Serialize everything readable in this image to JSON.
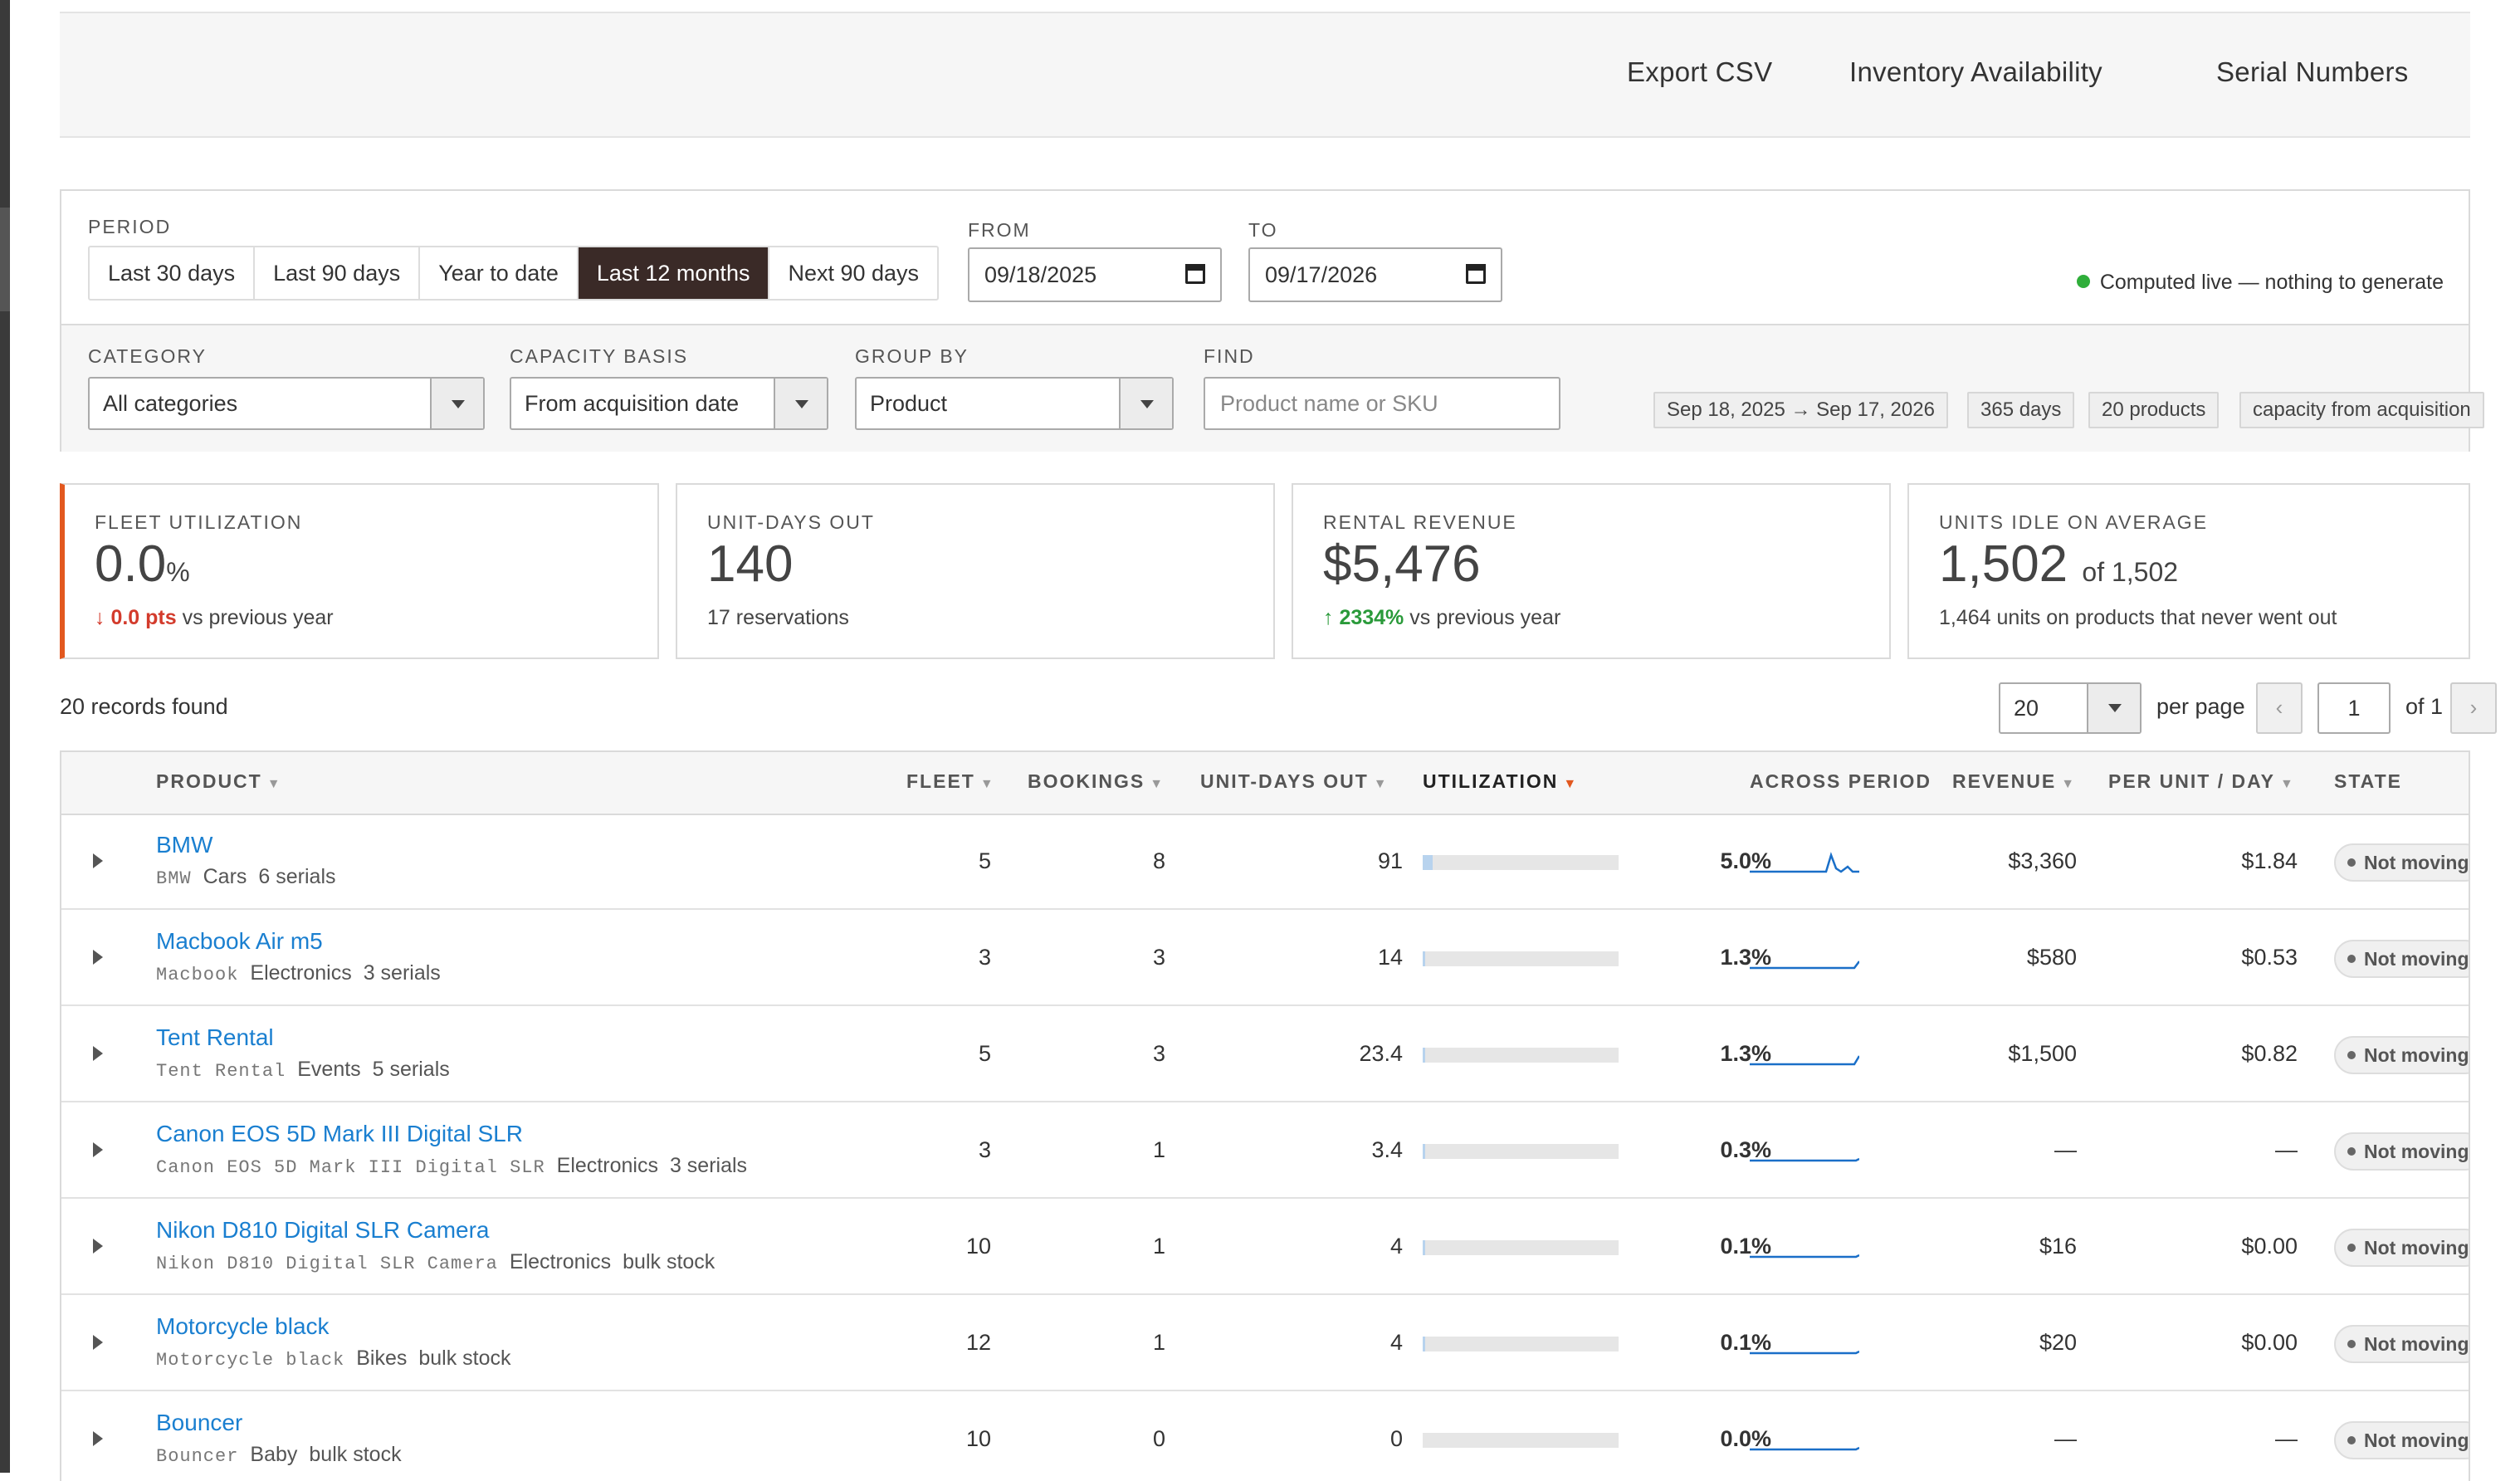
{
  "toolbar": {
    "export_csv": "Export CSV",
    "inventory_availability": "Inventory Availability",
    "serial_numbers": "Serial Numbers"
  },
  "filters": {
    "period_label": "PERIOD",
    "periods": [
      "Last 30 days",
      "Last 90 days",
      "Year to date",
      "Last 12 months",
      "Next 90 days"
    ],
    "active_period": "Last 12 months",
    "from_label": "FROM",
    "from_value": "09/18/2025",
    "to_label": "TO",
    "to_value": "09/17/2026",
    "live_status": "Computed live — nothing to generate",
    "category_label": "CATEGORY",
    "category_value": "All categories",
    "capacity_label": "CAPACITY BASIS",
    "capacity_value": "From acquisition date",
    "group_label": "GROUP BY",
    "group_value": "Product",
    "find_label": "FIND",
    "find_placeholder": "Product name or SKU",
    "chips": [
      "Sep 18, 2025 → Sep 17, 2026",
      "365 days",
      "20 products",
      "capacity from acquisition"
    ]
  },
  "kpis": {
    "fleet_utilization": {
      "label": "FLEET UTILIZATION",
      "value": "0.0",
      "unit": "%",
      "delta": "↓ 0.0 pts",
      "delta_suffix": "vs previous year"
    },
    "unit_days_out": {
      "label": "UNIT-DAYS OUT",
      "value": "140",
      "sub": "17 reservations"
    },
    "rental_revenue": {
      "label": "RENTAL REVENUE",
      "value": "$5,476",
      "delta": "↑ 2334%",
      "delta_suffix": "vs previous year"
    },
    "units_idle": {
      "label": "UNITS IDLE ON AVERAGE",
      "value": "1,502",
      "of": "of 1,502",
      "sub": "1,464 units on products that never went out"
    }
  },
  "pagination": {
    "records_found": "20 records found",
    "per_page_value": "20",
    "per_page_label": "per page",
    "prev": "‹",
    "page": "1",
    "of_label": "of  1",
    "next": "›"
  },
  "table": {
    "headers": {
      "product": "PRODUCT",
      "fleet": "FLEET",
      "bookings": "BOOKINGS",
      "unit_days_out": "UNIT-DAYS OUT",
      "utilization": "UTILIZATION",
      "across_period": "ACROSS PERIOD",
      "revenue": "REVENUE",
      "per_unit_day": "PER UNIT / DAY",
      "state": "STATE"
    },
    "rows": [
      {
        "name": "BMW",
        "sku": "BMW",
        "category": "Cars",
        "stock": "6 serials",
        "fleet": "5",
        "bookings": "8",
        "unit_days": "91",
        "utilization": "5.0%",
        "util_fraction": 0.05,
        "revenue": "$3,360",
        "per_unit_day": "$1.84",
        "state": "Not moving"
      },
      {
        "name": "Macbook Air m5",
        "sku": "Macbook",
        "category": "Electronics",
        "stock": "3 serials",
        "fleet": "3",
        "bookings": "3",
        "unit_days": "14",
        "utilization": "1.3%",
        "util_fraction": 0.013,
        "revenue": "$580",
        "per_unit_day": "$0.53",
        "state": "Not moving"
      },
      {
        "name": "Tent Rental",
        "sku": "Tent Rental",
        "category": "Events",
        "stock": "5 serials",
        "fleet": "5",
        "bookings": "3",
        "unit_days": "23.4",
        "utilization": "1.3%",
        "util_fraction": 0.013,
        "revenue": "$1,500",
        "per_unit_day": "$0.82",
        "state": "Not moving"
      },
      {
        "name": "Canon EOS 5D Mark III Digital SLR",
        "sku": "Canon EOS 5D Mark III Digital SLR",
        "category": "Electronics",
        "stock": "3 serials",
        "fleet": "3",
        "bookings": "1",
        "unit_days": "3.4",
        "utilization": "0.3%",
        "util_fraction": 0.003,
        "revenue": "—",
        "per_unit_day": "—",
        "state": "Not moving"
      },
      {
        "name": "Nikon D810 Digital SLR Camera",
        "sku": "Nikon D810 Digital SLR Camera",
        "category": "Electronics",
        "stock": "bulk stock",
        "fleet": "10",
        "bookings": "1",
        "unit_days": "4",
        "utilization": "0.1%",
        "util_fraction": 0.001,
        "revenue": "$16",
        "per_unit_day": "$0.00",
        "state": "Not moving"
      },
      {
        "name": "Motorcycle black",
        "sku": "Motorcycle black",
        "category": "Bikes",
        "stock": "bulk stock",
        "fleet": "12",
        "bookings": "1",
        "unit_days": "4",
        "utilization": "0.1%",
        "util_fraction": 0.001,
        "revenue": "$20",
        "per_unit_day": "$0.00",
        "state": "Not moving"
      },
      {
        "name": "Bouncer",
        "sku": "Bouncer",
        "category": "Baby",
        "stock": "bulk stock",
        "fleet": "10",
        "bookings": "0",
        "unit_days": "0",
        "utilization": "0.0%",
        "util_fraction": 0.0,
        "revenue": "—",
        "per_unit_day": "—",
        "state": "Not moving"
      }
    ]
  },
  "colors": {
    "accent": "#e2581f",
    "link": "#1a7fd0",
    "active_segment": "#3a2a27",
    "live_dot": "#2fae3a",
    "down": "#d33b2c",
    "up": "#2a9a3a",
    "spark": "#1a6fc8"
  }
}
